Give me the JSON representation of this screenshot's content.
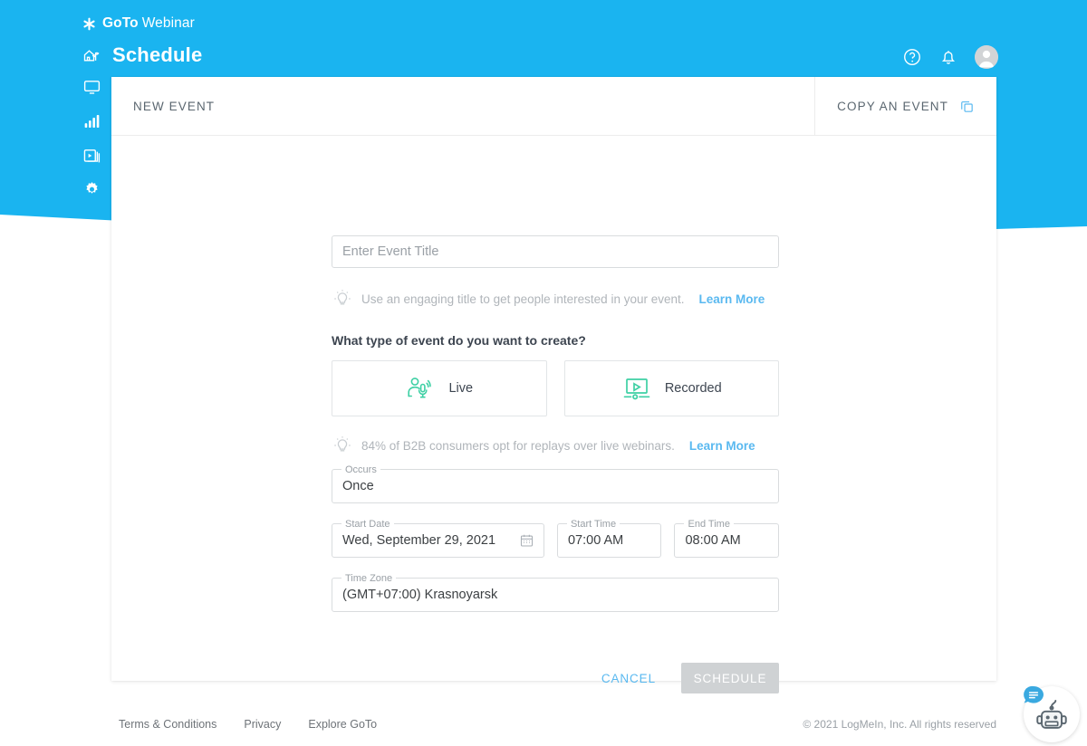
{
  "brand": {
    "goto": "GoTo",
    "webinar": "Webinar",
    "logo_icon": "goto-star-logo-icon"
  },
  "header": {
    "page_title": "Schedule",
    "home_icon": "home-icon",
    "help_icon": "help-circle-icon",
    "bell_icon": "bell-icon",
    "avatar_icon": "user-avatar-icon",
    "banner_color": "#1ab4f0"
  },
  "sidebar": {
    "items": [
      {
        "icon": "monitor-icon",
        "name": "sidebar-item-webinars"
      },
      {
        "icon": "bar-chart-icon",
        "name": "sidebar-item-analytics"
      },
      {
        "icon": "recordings-icon",
        "name": "sidebar-item-recordings"
      },
      {
        "icon": "gear-icon",
        "name": "sidebar-item-settings"
      }
    ]
  },
  "card": {
    "heading": "NEW EVENT",
    "copy_event_label": "COPY AN EVENT",
    "copy_event_icon": "copy-icon"
  },
  "form": {
    "event_title": {
      "value": "",
      "placeholder": "Enter Event Title"
    },
    "tip_title": {
      "icon": "lightbulb-icon",
      "text": "Use an engaging title to get people interested in your event.",
      "link": "Learn More"
    },
    "type_question": "What type of event do you want to create?",
    "event_types": [
      {
        "label": "Live",
        "icon": "person-microphone-icon"
      },
      {
        "label": "Recorded",
        "icon": "screen-play-icon"
      }
    ],
    "tip_type": {
      "icon": "lightbulb-icon",
      "text": "84% of B2B consumers opt for replays over live webinars.",
      "link": "Learn More"
    },
    "occurs": {
      "label": "Occurs",
      "value": "Once"
    },
    "start_date": {
      "label": "Start Date",
      "value": "Wed, September 29, 2021",
      "icon": "calendar-icon"
    },
    "start_time": {
      "label": "Start Time",
      "value": "07:00 AM"
    },
    "end_time": {
      "label": "End Time",
      "value": "08:00 AM"
    },
    "time_zone": {
      "label": "Time Zone",
      "value": "(GMT+07:00) Krasnoyarsk"
    },
    "cancel_label": "CANCEL",
    "schedule_label": "SCHEDULE"
  },
  "footer": {
    "links": [
      "Terms & Conditions",
      "Privacy",
      "Explore GoTo"
    ],
    "copyright": "© 2021 LogMeIn, Inc. All rights reserved"
  },
  "chat_widget": {
    "bot_icon": "chat-bot-icon",
    "badge_icon": "chat-bubble-icon"
  },
  "colors": {
    "brand_blue": "#1ab4f0",
    "link_blue": "#5ab9f0",
    "accent_green": "#3ed0a4",
    "disabled_grey": "#cfd2d4"
  }
}
